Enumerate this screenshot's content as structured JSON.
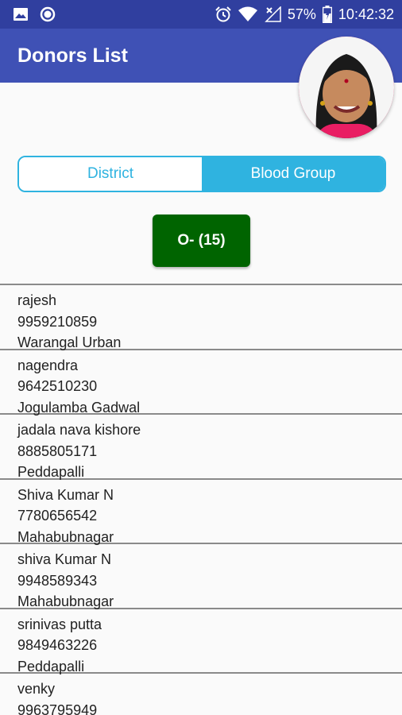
{
  "status_bar": {
    "battery": "57%",
    "time": "10:42:32",
    "icons": [
      "image-icon",
      "record-icon",
      "alarm-icon",
      "wifi-icon",
      "no-signal-icon",
      "battery-icon"
    ]
  },
  "app_bar": {
    "title": "Donors List"
  },
  "filter": {
    "district_label": "District",
    "blood_group_label": "Blood Group",
    "selected": "Blood Group"
  },
  "blood_group_button": {
    "label": "O- (15)"
  },
  "colors": {
    "primary": "#3f51b5",
    "primary_dark": "#303f9f",
    "accent": "#2fb3e0",
    "group_button": "#006400"
  },
  "donors": [
    {
      "name": "rajesh",
      "phone": "9959210859",
      "district": "Warangal Urban"
    },
    {
      "name": "nagendra",
      "phone": "9642510230",
      "district": "Jogulamba Gadwal"
    },
    {
      "name": "jadala nava kishore",
      "phone": "8885805171",
      "district": "Peddapalli"
    },
    {
      "name": "Shiva Kumar N",
      "phone": "7780656542",
      "district": "Mahabubnagar"
    },
    {
      "name": "shiva Kumar N",
      "phone": "9948589343",
      "district": "Mahabubnagar"
    },
    {
      "name": "srinivas putta",
      "phone": "9849463226",
      "district": "Peddapalli"
    },
    {
      "name": "venky",
      "phone": "9963795949",
      "district": ""
    }
  ]
}
